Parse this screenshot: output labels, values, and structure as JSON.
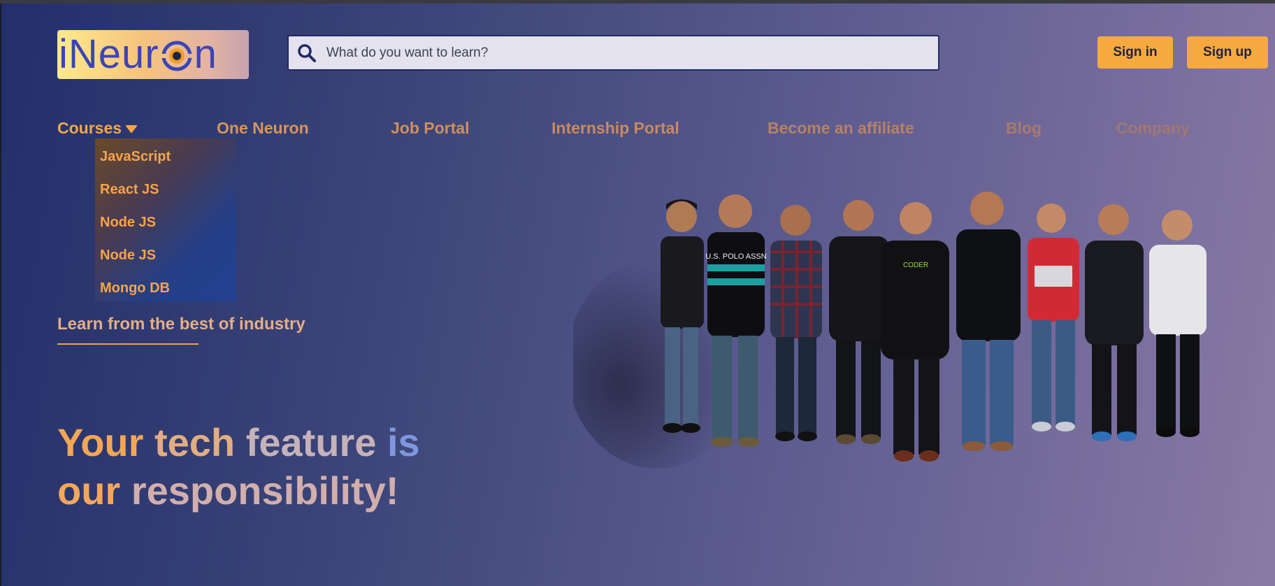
{
  "brand": {
    "logo_text_before": "iNeur",
    "logo_text_after": "n"
  },
  "search": {
    "placeholder": "What do you want to learn?"
  },
  "auth": {
    "signin_label": "Sign in",
    "signup_label": "Sign up"
  },
  "nav": {
    "courses_label": "Courses",
    "items": [
      "One Neuron",
      "Job Portal",
      "Internship Portal",
      "Become an affiliate",
      "Blog",
      "Company"
    ]
  },
  "courses_dropdown": [
    "JavaScript",
    "React JS",
    "Node JS",
    "Node JS",
    "Mongo DB"
  ],
  "tagline": "Learn from the best of industry",
  "hero": {
    "line1": [
      "Your",
      "tech",
      "feature",
      "is"
    ],
    "line2": [
      "our",
      "responsibility!"
    ]
  },
  "team_shirts": [
    "U.S. POLO ASSN",
    "CODER"
  ],
  "colors": {
    "accent": "#f5a93f",
    "search_border": "#1f2a66",
    "logo_text": "#3b45b8"
  }
}
